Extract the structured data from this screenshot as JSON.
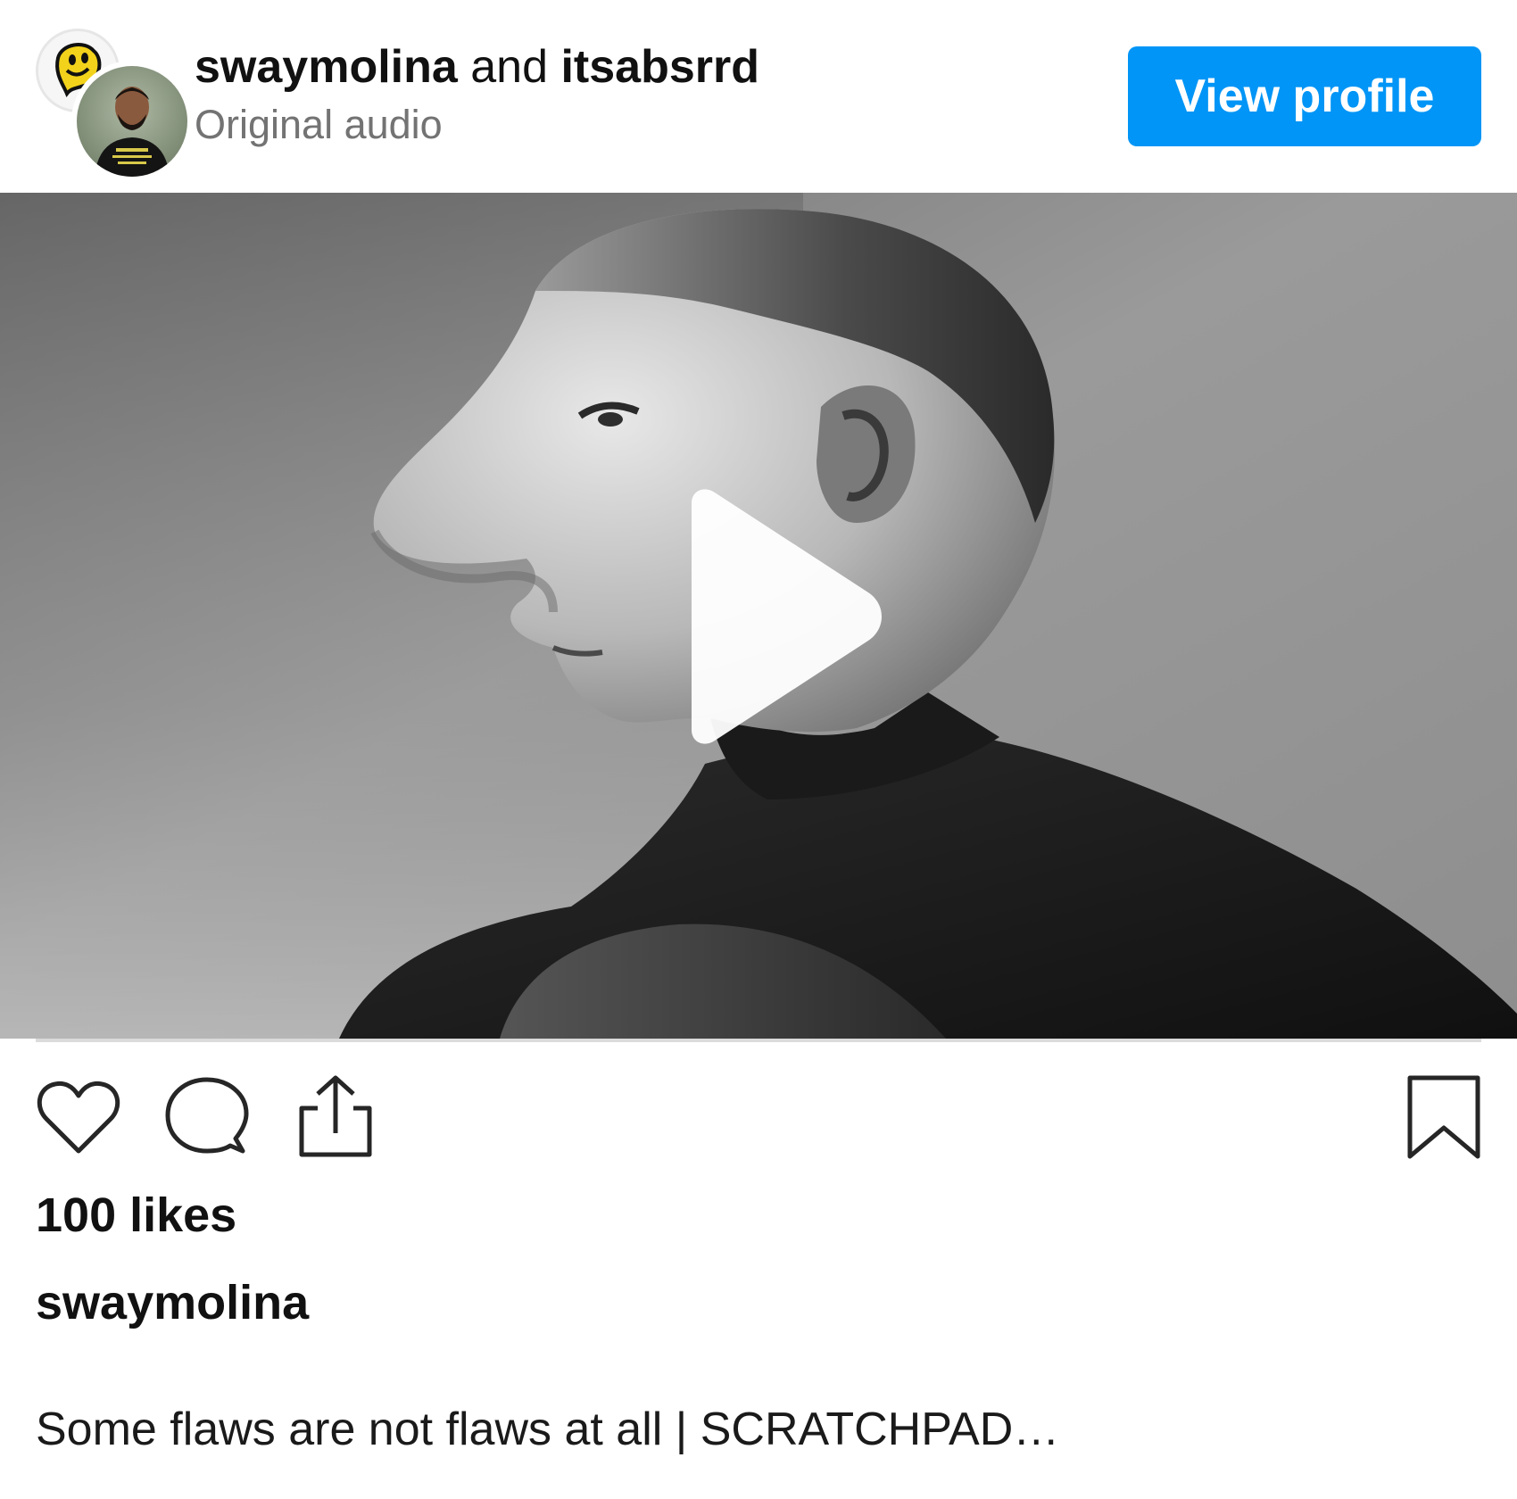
{
  "header": {
    "primary_user": "swaymolina",
    "joiner": "and",
    "collab_user": "itsabsrrd",
    "audio_label": "Original audio",
    "view_profile_label": "View profile"
  },
  "media": {
    "type": "video",
    "play_icon": "play-icon"
  },
  "actions": {
    "like_icon": "heart-icon",
    "comment_icon": "comment-bubble-icon",
    "share_icon": "share-upload-icon",
    "save_icon": "bookmark-icon"
  },
  "post": {
    "likes_text": "100 likes",
    "caption_user": "swaymolina",
    "caption_text": "Some flaws are not flaws at all | SCRATCHPAD…"
  },
  "colors": {
    "accent": "#0095f6",
    "secondary_text": "#737373",
    "divider": "#dbdbdb"
  }
}
